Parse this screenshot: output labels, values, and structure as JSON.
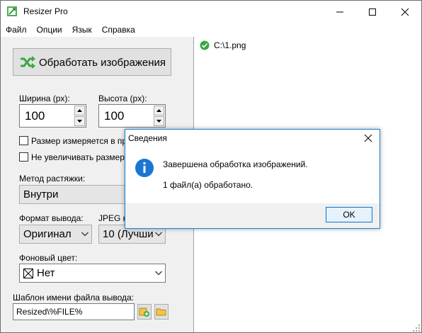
{
  "window": {
    "title": "Resizer Pro"
  },
  "menu": [
    "Файл",
    "Опции",
    "Язык",
    "Справка"
  ],
  "left": {
    "process_button": "Обработать изображения",
    "width_label": "Ширина (px):",
    "width_value": "100",
    "height_label": "Высота (px):",
    "height_value": "100",
    "checkbox1_label": "Размер измеряется в пр",
    "checkbox2_label": "Не увеличивать размер",
    "stretch_label": "Метод растяжки:",
    "stretch_value": "Внутри",
    "format_label": "Формат вывода:",
    "format_value": "Оригинал",
    "jpeg_label": "JPEG ка",
    "jpeg_value": "10 (Лучши",
    "bg_label": "Фоновый цвет:",
    "bg_value": "Нет",
    "template_label": "Шаблон имени файла вывода:",
    "template_value": "Resized\\%FILE%"
  },
  "file_list": [
    {
      "path": "C:\\1.png",
      "status": "done"
    }
  ],
  "dialog": {
    "title": "Сведения",
    "message1": "Завершена обработка изображений.",
    "message2": "1 файл(а) обработано.",
    "ok": "OK"
  },
  "colors": {
    "accent": "#0078d7",
    "success": "#3aa845",
    "info": "#1976d2"
  }
}
